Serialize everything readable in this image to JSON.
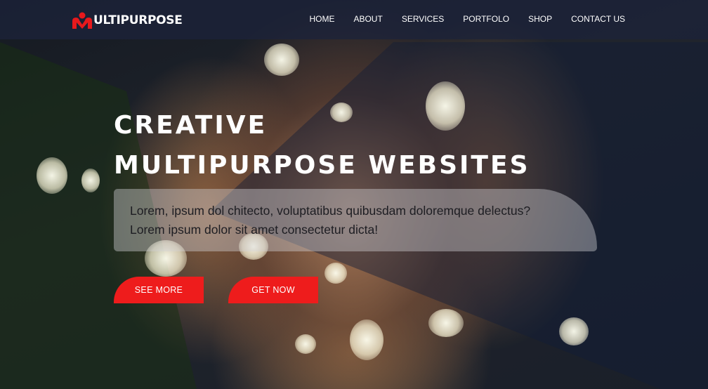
{
  "brand": {
    "logo_text": "ULTIPURPOSE",
    "logo_mark_color": "#e8191c"
  },
  "nav": {
    "items": [
      {
        "label": "HOME"
      },
      {
        "label": "ABOUT"
      },
      {
        "label": "SERVICES"
      },
      {
        "label": "PORTFOLO"
      },
      {
        "label": "SHOP"
      },
      {
        "label": "CONTACT US"
      }
    ]
  },
  "hero": {
    "headline_line1": "CREATIVE",
    "headline_line2": "MULTIPURPOSE WEBSITES",
    "description_line1": "Lorem, ipsum dol chitecto, voluptatibus quibusdam doloremque delectus?",
    "description_line2": "Lorem ipsum dolor sit amet consectetur dicta!",
    "buttons": {
      "see_more": "SEE MORE",
      "get_now": "GET NOW"
    },
    "accent_color": "#ee1c1c"
  }
}
